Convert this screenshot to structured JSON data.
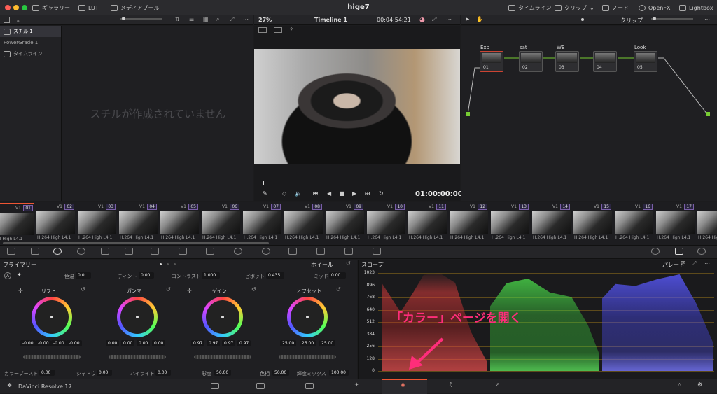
{
  "titlebar": {
    "gallery": "ギャラリー",
    "lut": "LUT",
    "media_pool": "メディアプール",
    "project_title": "hige7",
    "timeline": "タイムライン",
    "clip": "クリップ",
    "node": "ノード",
    "openfx": "OpenFX",
    "lightbox": "Lightbox"
  },
  "viewer": {
    "zoom": "27%",
    "timeline_name": "Timeline 1",
    "timecode": "00:04:54:21",
    "playhead_tc": "01:00:00:00"
  },
  "node_editor": {
    "mode": "クリップ",
    "nodes": [
      {
        "label": "Exp",
        "num": "01"
      },
      {
        "label": "sat",
        "num": "02"
      },
      {
        "label": "WB",
        "num": "03"
      },
      {
        "label": "",
        "num": "04"
      },
      {
        "label": "Look",
        "num": "05"
      }
    ]
  },
  "gallery": {
    "items": [
      "スチル 1",
      "PowerGrade 1",
      "タイムライン"
    ],
    "empty_message": "スチルが作成されていません"
  },
  "clips": [
    {
      "num": "01",
      "codec": "64 High L4.1"
    },
    {
      "num": "02",
      "codec": "H.264 High L4.1"
    },
    {
      "num": "03",
      "codec": "H.264 High L4.1"
    },
    {
      "num": "04",
      "codec": "H.264 High L4.1"
    },
    {
      "num": "05",
      "codec": "H.264 High L4.1"
    },
    {
      "num": "06",
      "codec": "H.264 High L4.1"
    },
    {
      "num": "07",
      "codec": "H.264 High L4.1"
    },
    {
      "num": "08",
      "codec": "H.264 High L4.1"
    },
    {
      "num": "09",
      "codec": "H.264 High L4.1"
    },
    {
      "num": "10",
      "codec": "H.264 High L4.1"
    },
    {
      "num": "11",
      "codec": "H.264 High L4.1"
    },
    {
      "num": "12",
      "codec": "H.264 High L4.1"
    },
    {
      "num": "13",
      "codec": "H.264 High L4.1"
    },
    {
      "num": "14",
      "codec": "H.264 High L4.1"
    },
    {
      "num": "15",
      "codec": "H.264 High L4.1"
    },
    {
      "num": "16",
      "codec": "H.264 High L4.1"
    },
    {
      "num": "17",
      "codec": "H.264 High L4.1"
    },
    {
      "num": "18",
      "codec": "H.264 High L4.1"
    }
  ],
  "track_label": "V1",
  "primary": {
    "title": "プライマリー",
    "mode": "ホイール",
    "hue_label": "色温",
    "hue": "0.0",
    "tint_label": "ティント",
    "tint": "0.00",
    "contrast_label": "コントラスト",
    "contrast": "1.000",
    "pivot_label": "ピボット",
    "pivot": "0.435",
    "mid_label": "ミッド",
    "mid": "0.00",
    "wheels": [
      {
        "name": "リフト",
        "values": [
          "-0.00",
          "-0.00",
          "-0.00",
          "-0.00"
        ]
      },
      {
        "name": "ガンマ",
        "values": [
          "0.00",
          "0.00",
          "0.00",
          "0.00"
        ]
      },
      {
        "name": "ゲイン",
        "values": [
          "0.97",
          "0.97",
          "0.97",
          "0.97"
        ]
      },
      {
        "name": "オフセット",
        "values": [
          "25.00",
          "25.00",
          "25.00"
        ]
      }
    ],
    "color_boost_label": "カラーブースト",
    "color_boost": "0.00",
    "shadow_label": "シャドウ",
    "shadow": "0.00",
    "highlight_label": "ハイライト",
    "highlight": "0.00",
    "sat_label": "彩度",
    "sat": "50.00",
    "hue2_label": "色相",
    "hue2": "50.00",
    "lum_mix_label": "輝度ミックス",
    "lum_mix": "100.00"
  },
  "scope": {
    "title": "スコープ",
    "mode": "パレード",
    "ticks": [
      "1023",
      "896",
      "768",
      "640",
      "512",
      "384",
      "256",
      "128",
      "0"
    ],
    "annotation": "「カラー」ページを開く",
    "annotation_color": "#ff2d7a"
  },
  "footer": {
    "app_name": "DaVinci Resolve 17"
  }
}
